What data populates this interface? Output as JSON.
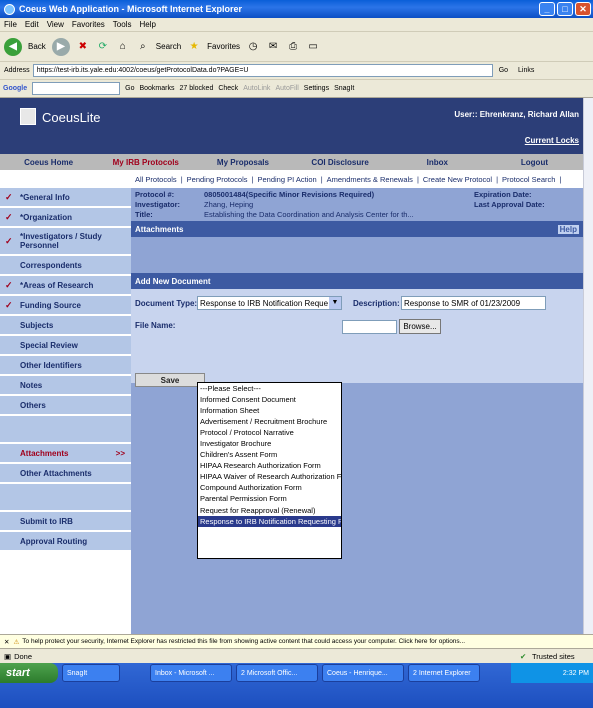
{
  "window": {
    "title": "Coeus Web Application - Microsoft Internet Explorer"
  },
  "menu": [
    "File",
    "Edit",
    "View",
    "Favorites",
    "Tools",
    "Help"
  ],
  "toolbar": {
    "back": "Back",
    "search": "Search",
    "favorites": "Favorites"
  },
  "address": {
    "label": "Address",
    "url": "https://test-irb.its.yale.edu:4002/coeus/getProtocolData.do?PAGE=U",
    "go": "Go",
    "links": "Links"
  },
  "googlebar": {
    "brand": "Google",
    "go": "Go",
    "bookmarks": "Bookmarks",
    "blocked": "27 blocked",
    "check": "Check",
    "autolink": "AutoLink",
    "autofill": "AutoFill",
    "settings": "Settings",
    "snagit": "SnagIt"
  },
  "app": {
    "logo": "CoeusLite",
    "user": "User:: Ehrenkranz, Richard Allan",
    "current_locks": "Current Locks",
    "topnav": [
      "Coeus Home",
      "My IRB Protocols",
      "My Proposals",
      "COI Disclosure",
      "Inbox",
      "Logout"
    ],
    "subnav": [
      "All Protocols",
      "Pending Protocols",
      "Pending PI Action",
      "Amendments & Renewals",
      "Create New Protocol",
      "Protocol Search"
    ]
  },
  "leftnav": [
    {
      "label": "*General Info",
      "check": "✓"
    },
    {
      "label": "*Organization",
      "check": "✓"
    },
    {
      "label": "*Investigators / Study Personnel",
      "check": "✓"
    },
    {
      "label": "Correspondents",
      "check": ""
    },
    {
      "label": "*Areas of Research",
      "check": "✓"
    },
    {
      "label": "Funding Source",
      "check": "✓"
    },
    {
      "label": "Subjects",
      "check": ""
    },
    {
      "label": "Special Review",
      "check": ""
    },
    {
      "label": "Other Identifiers",
      "check": ""
    },
    {
      "label": "Notes",
      "check": ""
    },
    {
      "label": "Others",
      "check": ""
    },
    {
      "label": "",
      "check": ""
    },
    {
      "label": "Attachments",
      "check": "",
      "arrow": ">>"
    },
    {
      "label": "Other Attachments",
      "check": ""
    },
    {
      "label": "",
      "check": ""
    },
    {
      "label": "Submit to IRB",
      "check": ""
    },
    {
      "label": "Approval Routing",
      "check": ""
    }
  ],
  "protocol": {
    "protocol_label": "Protocol #:",
    "protocol_value": "0805001484(Specific Minor Revisions Required)",
    "investigator_label": "Investigator:",
    "investigator_value": "Zhang, Heping",
    "title_label": "Title:",
    "title_value": "Establishing the Data Coordination and Analysis Center for th...",
    "expiration_label": "Expiration Date:",
    "approval_label": "Last Approval Date:"
  },
  "attachments": {
    "title": "Attachments",
    "help": "Help"
  },
  "form": {
    "section_title": "Add New Document",
    "doctype_label": "Document Type:",
    "doctype_value": "Response to IRB Notification Requesting",
    "desc_label": "Description:",
    "desc_value": "Response to SMR of 01/23/2009",
    "filename_label": "File Name:",
    "browse": "Browse...",
    "save": "Save"
  },
  "dropdown_options": [
    "---Please Select---",
    "Informed Consent Document",
    "Information Sheet",
    "Advertisement / Recruitment Brochure",
    "Protocol / Protocol Narrative",
    "Investigator Brochure",
    "Children's Assent Form",
    "HIPAA Research Authorization Form",
    "HIPAA Waiver of Research Authorization Form",
    "Compound Authorization Form",
    "Parental Permission Form",
    "Request for Reapproval (Renewal)",
    "Response to IRB Notification Requesting Re"
  ],
  "infobar": "To help protect your security, Internet Explorer has restricted this file from showing active content that could access your computer. Click here for options...",
  "status": {
    "left": "Done",
    "zone": "Trusted sites"
  },
  "taskbar": {
    "start": "start",
    "items": [
      "SnagIt",
      "Inbox - Microsoft ...",
      "2 Microsoft Offic...",
      "Coeus - Henrique...",
      "2 Internet Explorer"
    ],
    "time": "2:32 PM"
  }
}
